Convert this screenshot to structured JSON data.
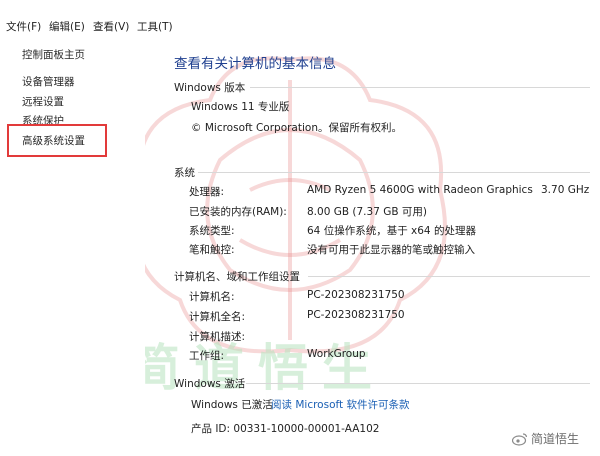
{
  "menu": {
    "file": "文件(F)",
    "edit": "编辑(E)",
    "view": "查看(V)",
    "tools": "工具(T)"
  },
  "sidebar": {
    "items": [
      {
        "label": "控制面板主页"
      },
      {
        "label": "设备管理器"
      },
      {
        "label": "远程设置"
      },
      {
        "label": "系统保护"
      },
      {
        "label": "高级系统设置"
      }
    ]
  },
  "main": {
    "title": "查看有关计算机的基本信息",
    "windows_edition": {
      "heading": "Windows 版本",
      "edition": "Windows 11 专业版",
      "copyright": "© Microsoft Corporation。保留所有权利。"
    },
    "system": {
      "heading": "系统",
      "processor_label": "处理器:",
      "processor_value": "AMD Ryzen 5 4600G with Radeon Graphics",
      "processor_speed": "3.70 GHz",
      "ram_label": "已安装的内存(RAM):",
      "ram_value": "8.00 GB (7.37 GB 可用)",
      "type_label": "系统类型:",
      "type_value": "64 位操作系统，基于 x64 的处理器",
      "pen_label": "笔和触控:",
      "pen_value": "没有可用于此显示器的笔或触控输入"
    },
    "computer": {
      "heading": "计算机名、域和工作组设置",
      "name_label": "计算机名:",
      "name_value": "PC-202308231750",
      "fullname_label": "计算机全名:",
      "fullname_value": "PC-202308231750",
      "desc_label": "计算机描述:",
      "desc_value": "",
      "workgroup_label": "工作组:",
      "workgroup_value": "WorkGroup"
    },
    "activation": {
      "heading": "Windows 激活",
      "status": "Windows 已激活",
      "license_link": "阅读 Microsoft 软件许可条款",
      "product_id": "产品 ID: 00331-10000-00001-AA102"
    }
  },
  "watermark": {
    "text": "简道悟生",
    "logo_text": "简道悟生"
  },
  "colors": {
    "title_blue": "#1e3f8f",
    "link_blue": "#1a5fb4",
    "highlight_red": "#e23a3a",
    "watermark_red": "#e88f8f",
    "watermark_green": "#b8e3bf"
  }
}
